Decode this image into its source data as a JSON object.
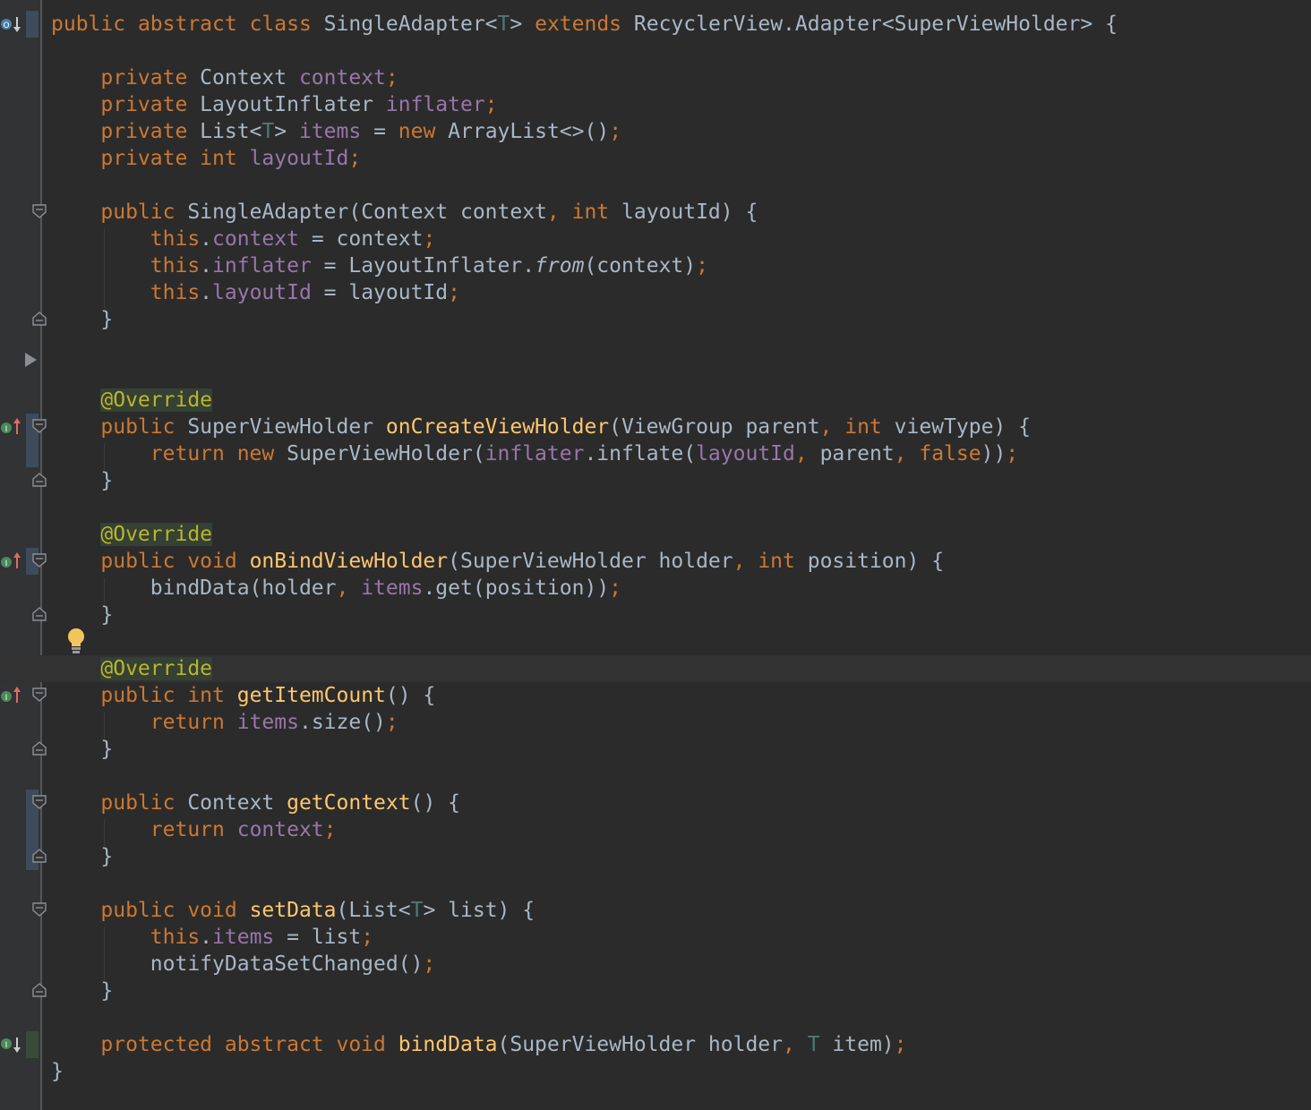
{
  "colors": {
    "background": "#2b2b2b",
    "gutter": "#313335",
    "caret_row": "#323232",
    "keyword": "#cc7832",
    "plain": "#a9b7c6",
    "field": "#9876aa",
    "method_decl": "#ffc66d",
    "annotation": "#bbb529",
    "type_param": "#507874",
    "keyword_value": "#cc7832"
  },
  "code_lines": [
    {
      "row": 0,
      "tokens": [
        [
          "k",
          "public "
        ],
        [
          "k",
          "abstract "
        ],
        [
          "k",
          "class "
        ],
        [
          "p",
          "SingleAdapter<"
        ],
        [
          "t",
          "T"
        ],
        [
          "p",
          "> "
        ],
        [
          "k",
          "extends "
        ],
        [
          "p",
          "RecyclerView.Adapter<SuperViewHolder> {"
        ]
      ]
    },
    {
      "row": 2,
      "tokens": [
        [
          "p",
          "    "
        ],
        [
          "k",
          "private "
        ],
        [
          "p",
          "Context "
        ],
        [
          "f",
          "context"
        ],
        [
          "k",
          ";"
        ]
      ]
    },
    {
      "row": 3,
      "tokens": [
        [
          "p",
          "    "
        ],
        [
          "k",
          "private "
        ],
        [
          "p",
          "LayoutInflater "
        ],
        [
          "f",
          "inflater"
        ],
        [
          "k",
          ";"
        ]
      ]
    },
    {
      "row": 4,
      "tokens": [
        [
          "p",
          "    "
        ],
        [
          "k",
          "private "
        ],
        [
          "p",
          "List<"
        ],
        [
          "t",
          "T"
        ],
        [
          "p",
          "> "
        ],
        [
          "f",
          "items "
        ],
        [
          "p",
          "= "
        ],
        [
          "k",
          "new "
        ],
        [
          "p",
          "ArrayList<>()"
        ],
        [
          "k",
          ";"
        ]
      ]
    },
    {
      "row": 5,
      "tokens": [
        [
          "p",
          "    "
        ],
        [
          "k",
          "private int "
        ],
        [
          "f",
          "layoutId"
        ],
        [
          "k",
          ";"
        ]
      ]
    },
    {
      "row": 7,
      "tokens": [
        [
          "p",
          "    "
        ],
        [
          "k",
          "public "
        ],
        [
          "p",
          "SingleAdapter(Context context"
        ],
        [
          "k",
          ", int "
        ],
        [
          "p",
          "layoutId) {"
        ]
      ]
    },
    {
      "row": 8,
      "tokens": [
        [
          "p",
          "        "
        ],
        [
          "k",
          "this"
        ],
        [
          "p",
          "."
        ],
        [
          "f",
          "context "
        ],
        [
          "p",
          "= context"
        ],
        [
          "k",
          ";"
        ]
      ]
    },
    {
      "row": 9,
      "tokens": [
        [
          "p",
          "        "
        ],
        [
          "k",
          "this"
        ],
        [
          "p",
          "."
        ],
        [
          "f",
          "inflater "
        ],
        [
          "p",
          "= LayoutInflater."
        ],
        [
          "i",
          "from"
        ],
        [
          "p",
          "(context)"
        ],
        [
          "k",
          ";"
        ]
      ]
    },
    {
      "row": 10,
      "tokens": [
        [
          "p",
          "        "
        ],
        [
          "k",
          "this"
        ],
        [
          "p",
          "."
        ],
        [
          "f",
          "layoutId "
        ],
        [
          "p",
          "= layoutId"
        ],
        [
          "k",
          ";"
        ]
      ]
    },
    {
      "row": 11,
      "tokens": [
        [
          "p",
          "    }"
        ]
      ]
    },
    {
      "row": 14,
      "tokens": [
        [
          "p",
          "    "
        ],
        [
          "a",
          "@Override"
        ]
      ]
    },
    {
      "row": 15,
      "tokens": [
        [
          "p",
          "    "
        ],
        [
          "k",
          "public "
        ],
        [
          "p",
          "SuperViewHolder "
        ],
        [
          "m",
          "onCreateViewHolder"
        ],
        [
          "p",
          "(ViewGroup parent"
        ],
        [
          "k",
          ", int "
        ],
        [
          "p",
          "viewType) {"
        ]
      ]
    },
    {
      "row": 16,
      "tokens": [
        [
          "p",
          "        "
        ],
        [
          "k",
          "return new "
        ],
        [
          "p",
          "SuperViewHolder("
        ],
        [
          "f",
          "inflater"
        ],
        [
          "p",
          ".inflate("
        ],
        [
          "f",
          "layoutId"
        ],
        [
          "k",
          ", "
        ],
        [
          "p",
          "parent"
        ],
        [
          "k",
          ", false"
        ],
        [
          "p",
          "))"
        ],
        [
          "k",
          ";"
        ]
      ]
    },
    {
      "row": 17,
      "tokens": [
        [
          "p",
          "    }"
        ]
      ]
    },
    {
      "row": 19,
      "tokens": [
        [
          "p",
          "    "
        ],
        [
          "a",
          "@Override"
        ]
      ]
    },
    {
      "row": 20,
      "tokens": [
        [
          "p",
          "    "
        ],
        [
          "k",
          "public void "
        ],
        [
          "m",
          "onBindViewHolder"
        ],
        [
          "p",
          "(SuperViewHolder holder"
        ],
        [
          "k",
          ", int "
        ],
        [
          "p",
          "position) {"
        ]
      ]
    },
    {
      "row": 21,
      "tokens": [
        [
          "p",
          "        bindData(holder"
        ],
        [
          "k",
          ", "
        ],
        [
          "f",
          "items"
        ],
        [
          "p",
          ".get(position))"
        ],
        [
          "k",
          ";"
        ]
      ]
    },
    {
      "row": 22,
      "tokens": [
        [
          "p",
          "    }"
        ]
      ]
    },
    {
      "row": 24,
      "tokens": [
        [
          "p",
          "    "
        ],
        [
          "a",
          "@Override"
        ]
      ]
    },
    {
      "row": 25,
      "tokens": [
        [
          "p",
          "    "
        ],
        [
          "k",
          "public int "
        ],
        [
          "m",
          "getItemCount"
        ],
        [
          "p",
          "() {"
        ]
      ]
    },
    {
      "row": 26,
      "tokens": [
        [
          "p",
          "        "
        ],
        [
          "k",
          "return "
        ],
        [
          "f",
          "items"
        ],
        [
          "p",
          ".size()"
        ],
        [
          "k",
          ";"
        ]
      ]
    },
    {
      "row": 27,
      "tokens": [
        [
          "p",
          "    }"
        ]
      ]
    },
    {
      "row": 29,
      "tokens": [
        [
          "p",
          "    "
        ],
        [
          "k",
          "public "
        ],
        [
          "p",
          "Context "
        ],
        [
          "m",
          "getContext"
        ],
        [
          "p",
          "() {"
        ]
      ]
    },
    {
      "row": 30,
      "tokens": [
        [
          "p",
          "        "
        ],
        [
          "k",
          "return "
        ],
        [
          "f",
          "context"
        ],
        [
          "k",
          ";"
        ]
      ]
    },
    {
      "row": 31,
      "tokens": [
        [
          "p",
          "    }"
        ]
      ]
    },
    {
      "row": 33,
      "tokens": [
        [
          "p",
          "    "
        ],
        [
          "k",
          "public void "
        ],
        [
          "m",
          "setData"
        ],
        [
          "p",
          "(List<"
        ],
        [
          "t",
          "T"
        ],
        [
          "p",
          "> list) {"
        ]
      ]
    },
    {
      "row": 34,
      "tokens": [
        [
          "p",
          "        "
        ],
        [
          "k",
          "this"
        ],
        [
          "p",
          "."
        ],
        [
          "f",
          "items "
        ],
        [
          "p",
          "= list"
        ],
        [
          "k",
          ";"
        ]
      ]
    },
    {
      "row": 35,
      "tokens": [
        [
          "p",
          "        notifyDataSetChanged()"
        ],
        [
          "k",
          ";"
        ]
      ]
    },
    {
      "row": 36,
      "tokens": [
        [
          "p",
          "    }"
        ]
      ]
    },
    {
      "row": 38,
      "tokens": [
        [
          "p",
          "    "
        ],
        [
          "k",
          "protected abstract void "
        ],
        [
          "m",
          "bindData"
        ],
        [
          "p",
          "(SuperViewHolder holder"
        ],
        [
          "k",
          ", "
        ],
        [
          "t",
          "T "
        ],
        [
          "p",
          "item)"
        ],
        [
          "k",
          ";"
        ]
      ]
    },
    {
      "row": 39,
      "tokens": [
        [
          "p",
          "}"
        ]
      ]
    }
  ],
  "gutter_icons": {
    "overridden_icon": "implemented-down-arrow-icon",
    "implements_icon": "implements-up-arrow-icon",
    "fold_start_icon": "fold-start-icon",
    "fold_end_icon": "fold-end-icon",
    "collapsed_icon": "collapsed-region-arrow-icon",
    "intention_icon": "lightbulb-icon"
  }
}
